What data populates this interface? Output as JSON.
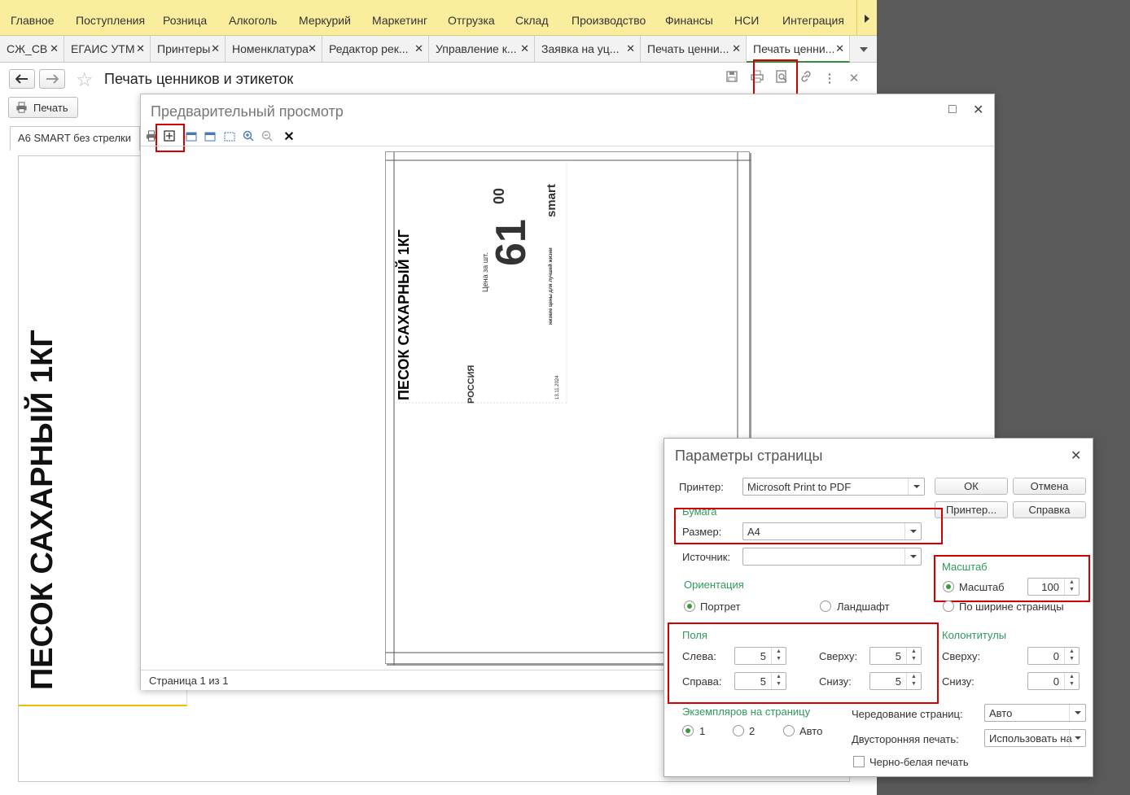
{
  "top_menu": [
    "Главное",
    "Поступления",
    "Розница",
    "Алкоголь",
    "Меркурий",
    "Маркетинг",
    "Отгрузка",
    "Склад",
    "Производство",
    "Финансы",
    "НСИ",
    "Интеграция"
  ],
  "tabs": [
    "СЖ_СВ",
    "ЕГАИС УТМ",
    "Принтеры",
    "Номенклатура",
    "Редактор рек...",
    "Управление к...",
    "Заявка на уц...",
    "Печать ценни...",
    "Печать ценни..."
  ],
  "form": {
    "title": "Печать ценников и этикеток",
    "print_button": "Печать",
    "subtab": "А6 SMART без стрелки",
    "big_label_text": "ПЕСОК САХАРНЫЙ 1КГ"
  },
  "preview": {
    "title": "Предварительный просмотр",
    "status": "Страница 1 из 1",
    "label": {
      "product": "ПЕСОК САХАРНЫЙ 1КГ",
      "price_caption": "Цена за шт.",
      "price_int": "61",
      "price_frac": "00",
      "brand": "smart",
      "slogan": "низкие цены для лучшей жизни",
      "country": "РОССИЯ",
      "date": "13.11.2024"
    }
  },
  "page_setup": {
    "title": "Параметры страницы",
    "printer_label": "Принтер:",
    "printer_value": "Microsoft Print to PDF",
    "ok": "ОК",
    "cancel": "Отмена",
    "printer_btn": "Принтер...",
    "help_btn": "Справка",
    "paper_group": "Бумага",
    "size_label": "Размер:",
    "size_value": "А4",
    "source_label": "Источник:",
    "source_value": "",
    "orientation_group": "Ориентация",
    "portrait": "Портрет",
    "landscape": "Ландшафт",
    "scale_group": "Масштаб",
    "scale_label": "Масштаб",
    "scale_value": "100",
    "fit_width": "По ширине страницы",
    "margins_group": "Поля",
    "left_label": "Слева:",
    "left_value": "5",
    "top_label": "Сверху:",
    "top_value": "5",
    "right_label": "Справа:",
    "right_value": "5",
    "bottom_label": "Снизу:",
    "bottom_value": "5",
    "header_group": "Колонтитулы",
    "header_top_label": "Сверху:",
    "header_top_value": "0",
    "header_bottom_label": "Снизу:",
    "header_bottom_value": "0",
    "copies_group": "Экземпляров на страницу",
    "copies_1": "1",
    "copies_2": "2",
    "copies_auto": "Авто",
    "alternation_label": "Чередование страниц:",
    "alternation_value": "Авто",
    "duplex_label": "Двусторонняя печать:",
    "duplex_value": "Использовать на",
    "bw_label": "Черно-белая печать"
  }
}
